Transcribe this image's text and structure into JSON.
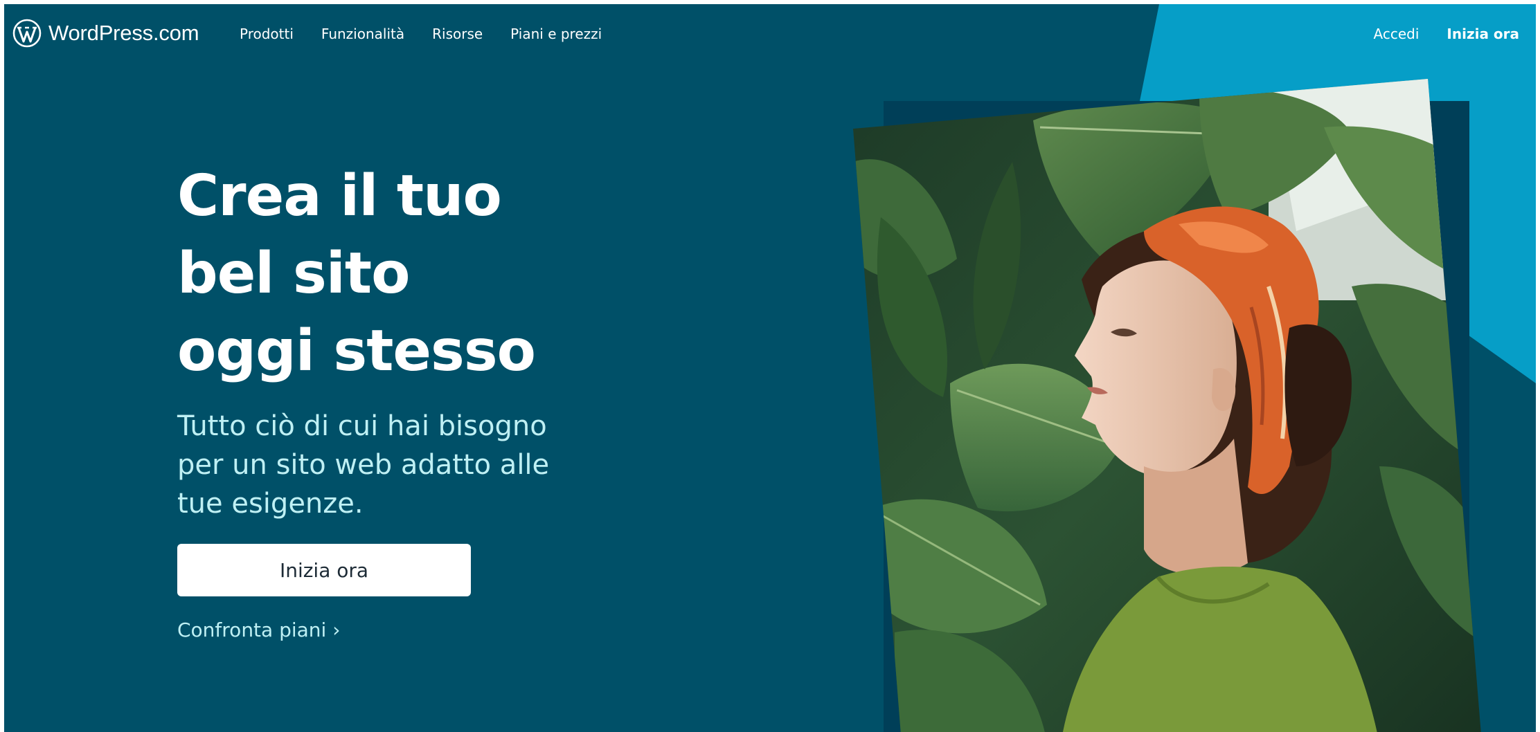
{
  "brand": {
    "name": "WordPress.com",
    "logo_icon": "wordpress-logo-icon"
  },
  "nav": {
    "links": [
      {
        "label": "Prodotti"
      },
      {
        "label": "Funzionalità"
      },
      {
        "label": "Risorse"
      },
      {
        "label": "Piani e prezzi"
      }
    ],
    "login_label": "Accedi",
    "start_label": "Inizia ora"
  },
  "hero": {
    "title_lines": [
      "Crea il tuo",
      "bel sito",
      "oggi stesso"
    ],
    "subtitle_lines": [
      "Tutto ciò di cui hai bisogno",
      "per un sito web adatto alle",
      "tue esigenze."
    ],
    "cta_label": "Inizia ora",
    "compare_label": "Confronta piani ›"
  },
  "photo": {
    "subject": "woman-with-orange-headscarf-among-plants-photo"
  },
  "colors": {
    "background": "#005068",
    "accent": "#069ec7",
    "subtitle_text": "#bff0f4",
    "button_bg": "#ffffff",
    "button_text": "#1d2b36"
  }
}
